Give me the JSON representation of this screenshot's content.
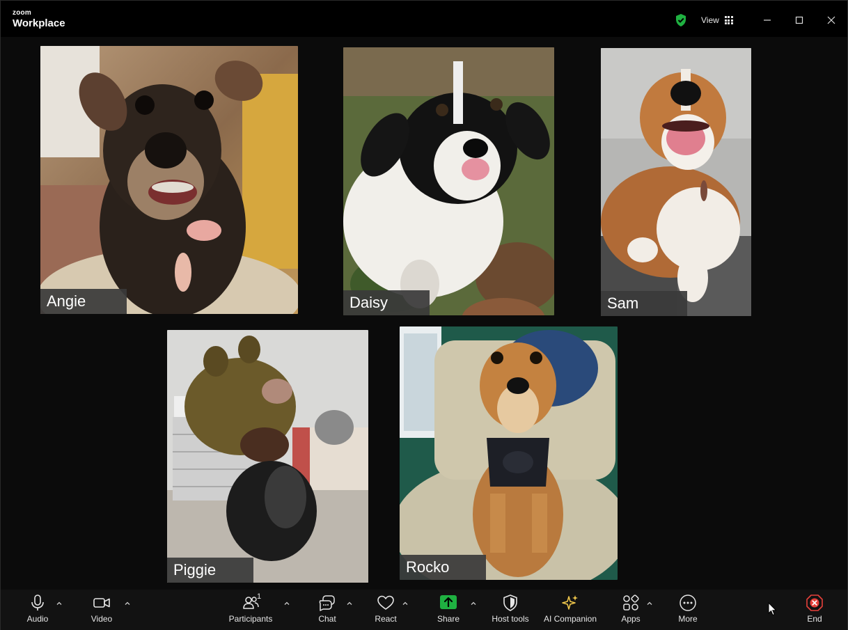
{
  "titlebar": {
    "brand_small": "zoom",
    "brand_big": "Workplace",
    "view_label": "View",
    "security_icon": "shield-check-icon",
    "colors": {
      "shield": "#1fb141"
    }
  },
  "participants": [
    {
      "name": "Angie"
    },
    {
      "name": "Daisy"
    },
    {
      "name": "Sam"
    },
    {
      "name": "Piggie"
    },
    {
      "name": "Rocko"
    }
  ],
  "toolbar": {
    "audio": "Audio",
    "video": "Video",
    "participants": "Participants",
    "participants_count": "1",
    "chat": "Chat",
    "react": "React",
    "share": "Share",
    "host_tools": "Host tools",
    "ai_companion": "AI Companion",
    "apps": "Apps",
    "more": "More",
    "end": "End",
    "colors": {
      "share": "#1fb141",
      "ai": "#f2c94c",
      "end": "#e5403a"
    }
  }
}
